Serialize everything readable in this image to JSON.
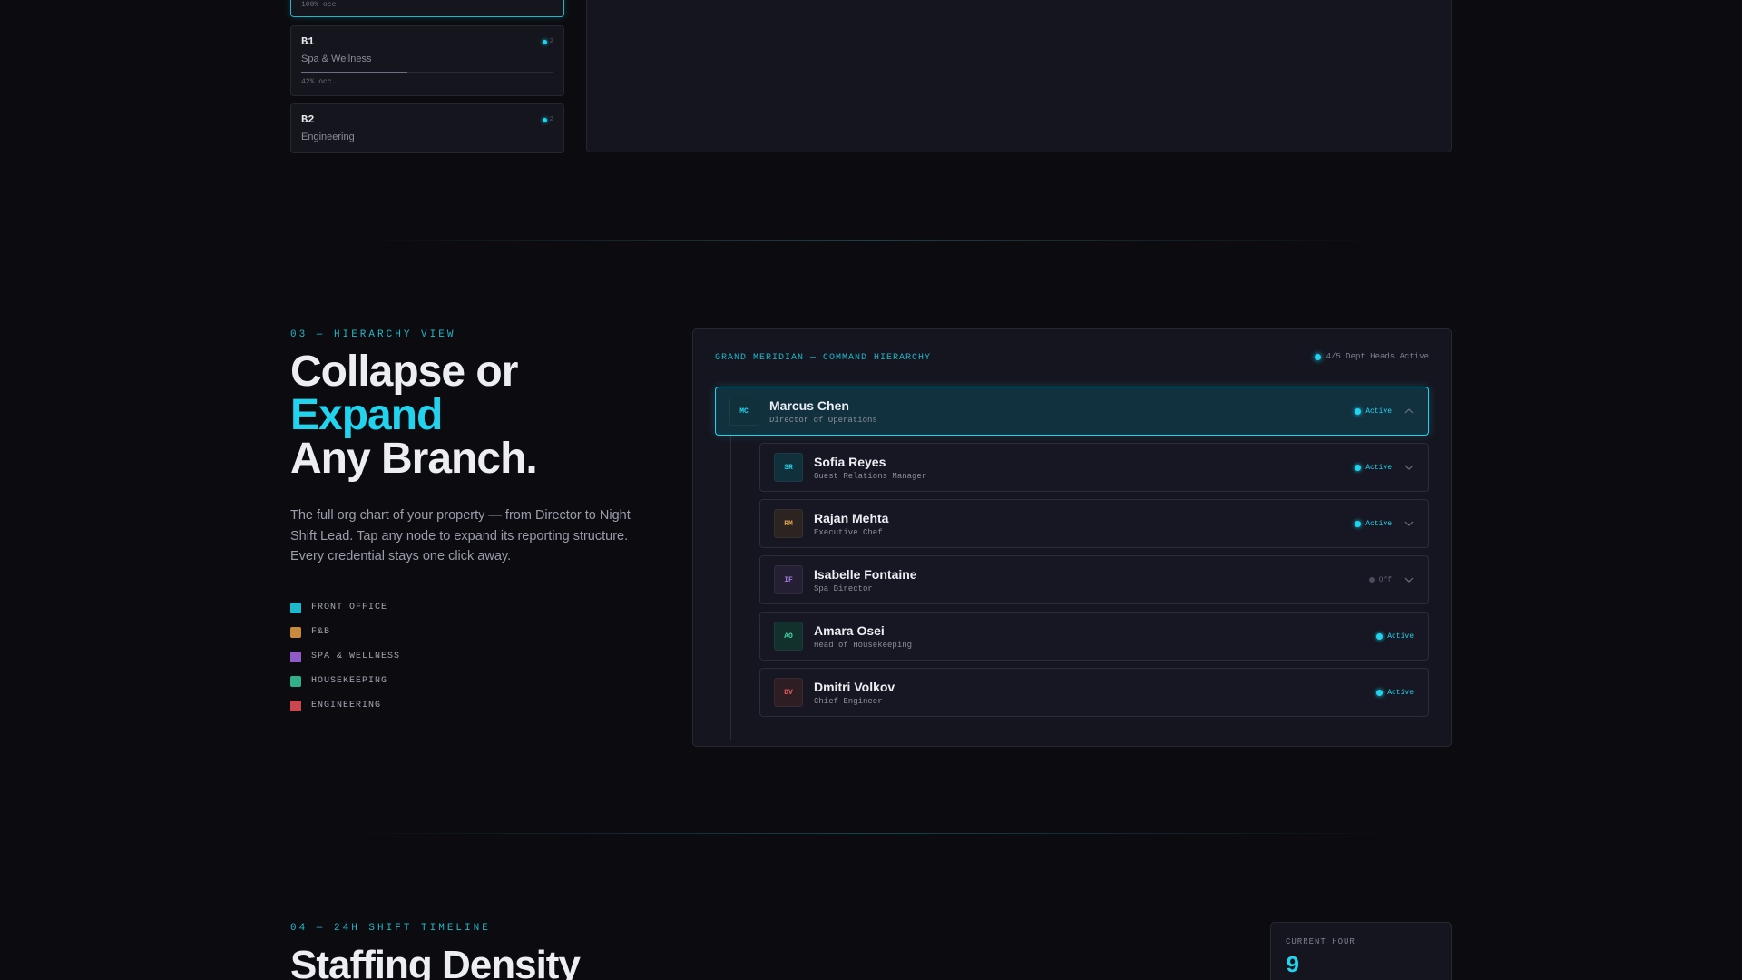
{
  "floors": [
    {
      "code": "",
      "subtitle": "",
      "count": "",
      "occupancy": 1.0,
      "occ_label": "100% occ."
    },
    {
      "code": "B1",
      "subtitle": "Spa & Wellness",
      "count": "2",
      "occupancy": 0.42,
      "occ_label": "42% occ."
    },
    {
      "code": "B2",
      "subtitle": "Engineering",
      "count": "2"
    }
  ],
  "hierarchy_section": {
    "eyebrow": "03 — HIERARCHY VIEW",
    "headline_line1": "Collapse or",
    "headline_accent": "Expand",
    "headline_line3": "Any Branch.",
    "description": "The full org chart of your property — from Director to Night Shift Lead. Tap any node to expand its reporting structure. Every credential stays one click away.",
    "legend": [
      {
        "label": "FRONT OFFICE",
        "color": "#1fb7c9"
      },
      {
        "label": "F&B",
        "color": "#c8893a"
      },
      {
        "label": "SPA & WELLNESS",
        "color": "#8e5cc4"
      },
      {
        "label": "HOUSEKEEPING",
        "color": "#2fb08a"
      },
      {
        "label": "ENGINEERING",
        "color": "#c8484e"
      }
    ],
    "panel": {
      "title": "GRAND MERIDIAN — COMMAND HIERARCHY",
      "status": "4/5 Dept Heads Active",
      "root": {
        "initials": "MC",
        "name": "Marcus Chen",
        "role": "Director of Operations",
        "status": "Active",
        "expanded": true
      },
      "children": [
        {
          "initials": "SR",
          "name": "Sofia Reyes",
          "role": "Guest Relations Manager",
          "status": "Active",
          "has_children": true,
          "accent": "#22d3ee",
          "bg": "#10303b"
        },
        {
          "initials": "RM",
          "name": "Rajan Mehta",
          "role": "Executive Chef",
          "status": "Active",
          "has_children": true,
          "accent": "#e0a04a",
          "bg": "#2c2420"
        },
        {
          "initials": "IF",
          "name": "Isabelle Fontaine",
          "role": "Spa Director",
          "status": "Off",
          "has_children": true,
          "accent": "#a877e6",
          "bg": "#251f34"
        },
        {
          "initials": "AO",
          "name": "Amara Osei",
          "role": "Head of Housekeeping",
          "status": "Active",
          "has_children": false,
          "accent": "#3ed6a8",
          "bg": "#12302c"
        },
        {
          "initials": "DV",
          "name": "Dmitri Volkov",
          "role": "Chief Engineer",
          "status": "Active",
          "has_children": false,
          "accent": "#ea5a5f",
          "bg": "#2e1d22"
        }
      ]
    }
  },
  "timeline_section": {
    "eyebrow": "04 — 24H SHIFT TIMELINE",
    "headline": "Staffing Density",
    "current_hour_label": "CURRENT HOUR",
    "current_hour": "9"
  },
  "colors": {
    "accent": "#22d3ee",
    "off": "#4a4d5a"
  }
}
